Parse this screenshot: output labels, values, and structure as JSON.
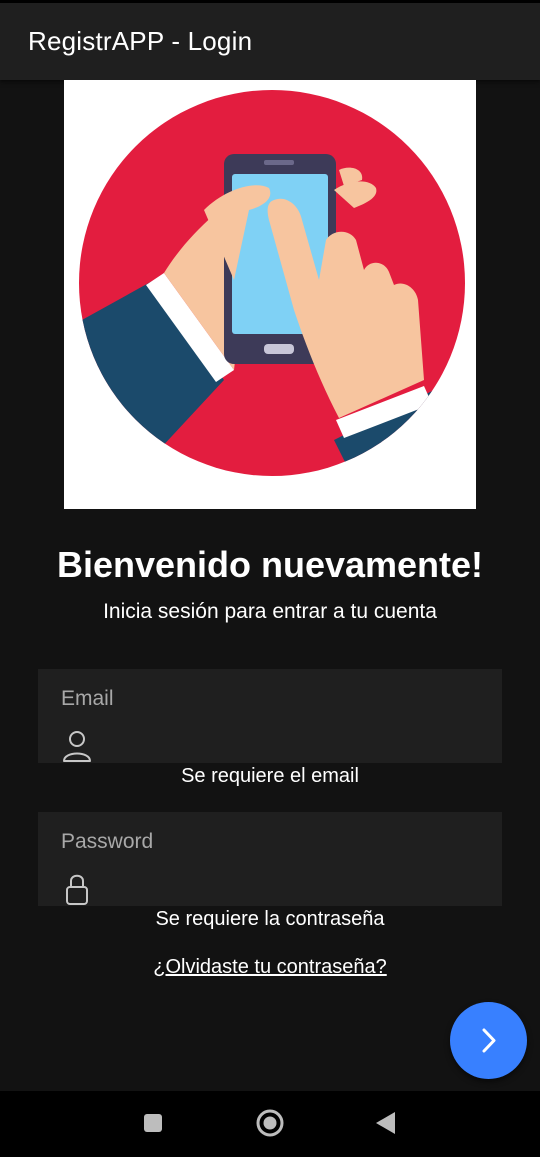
{
  "toolbar": {
    "title": "RegistrAPP - Login"
  },
  "hero": {
    "icon": "phone-touch-illustration"
  },
  "welcome": {
    "title": "Bienvenido nuevamente!",
    "subtitle": "Inicia sesión para entrar a tu cuenta"
  },
  "form": {
    "email": {
      "label": "Email",
      "value": "",
      "icon": "person-icon",
      "error": "Se requiere el email"
    },
    "password": {
      "label": "Password",
      "value": "",
      "icon": "lock-icon",
      "error": "Se requiere la contraseña"
    },
    "forgot_link": "¿Olvidaste tu contraseña?"
  },
  "fab": {
    "icon": "chevron-forward-icon"
  },
  "nav": {
    "icons": [
      "square-icon",
      "circle-home-icon",
      "back-triangle-icon"
    ]
  },
  "colors": {
    "background": "#121212",
    "toolbar": "#1f1f1f",
    "field": "#1f1f1f",
    "accent": "#3880ff",
    "hero_red": "#e31d3f",
    "sleeve": "#1b4a6b",
    "skin": "#f7c59f"
  }
}
